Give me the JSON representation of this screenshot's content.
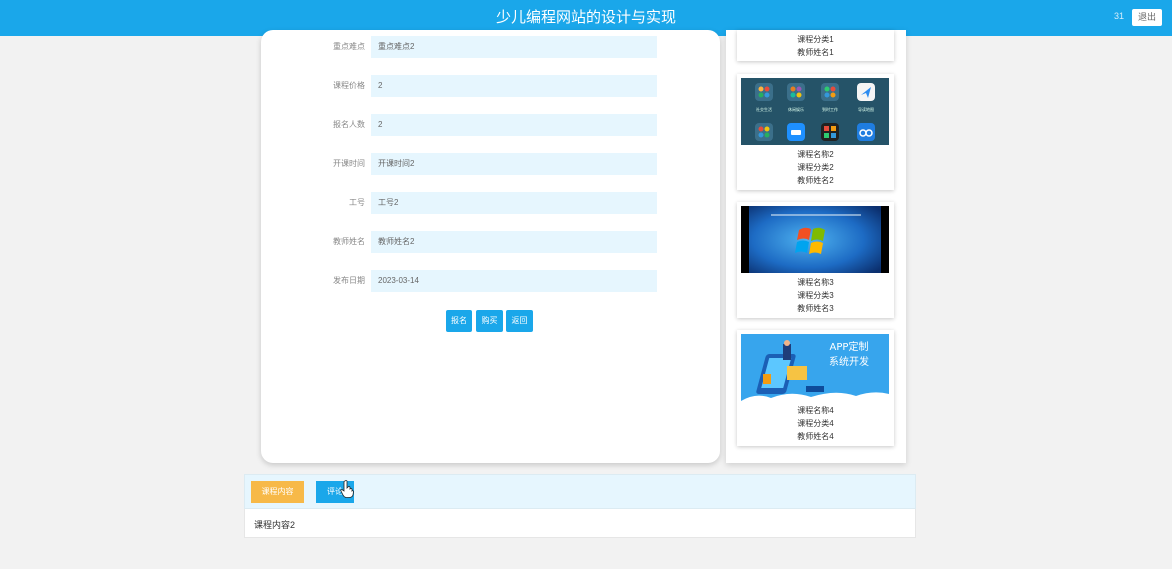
{
  "header": {
    "title": "少儿编程网站的设计与实现",
    "user_fragment": "31",
    "logout_label": "退出"
  },
  "detail": {
    "fields": [
      {
        "label": "重点难点",
        "value": "重点难点2"
      },
      {
        "label": "课程价格",
        "value": "2"
      },
      {
        "label": "报名人数",
        "value": "2"
      },
      {
        "label": "开课时间",
        "value": "开课时间2"
      },
      {
        "label": "工号",
        "value": "工号2"
      },
      {
        "label": "教师姓名",
        "value": "教师姓名2"
      },
      {
        "label": "发布日期",
        "value": "2023-03-14"
      }
    ],
    "buttons": {
      "enroll": "报名",
      "buy": "购买",
      "back": "返回"
    }
  },
  "side_courses": [
    {
      "lines": [
        "课程分类1",
        "教师姓名1"
      ],
      "partial": true
    },
    {
      "lines": [
        "课程名称2",
        "课程分类2",
        "教师姓名2"
      ],
      "thumb": "phone-apps-image"
    },
    {
      "lines": [
        "课程名称3",
        "课程分类3",
        "教师姓名3"
      ],
      "thumb": "windows-desktop-image"
    },
    {
      "lines": [
        "课程名称4",
        "课程分类4",
        "教师姓名4"
      ],
      "thumb": "app-custom-development-image",
      "thumb_text": [
        "APP定制",
        "系统开发"
      ]
    }
  ],
  "app_icon_labels": [
    "社交生活",
    "休闲娱乐",
    "到时工作",
    "导读地图"
  ],
  "tabs": {
    "content_label": "课程内容",
    "comment_label": "评论"
  },
  "tab_content": {
    "text": "课程内容2"
  },
  "colors": {
    "primary": "#1aa7ea",
    "tab_active": "#f7b948",
    "field_bg": "#e6f6fe",
    "page_bg": "#f2f2f2"
  }
}
